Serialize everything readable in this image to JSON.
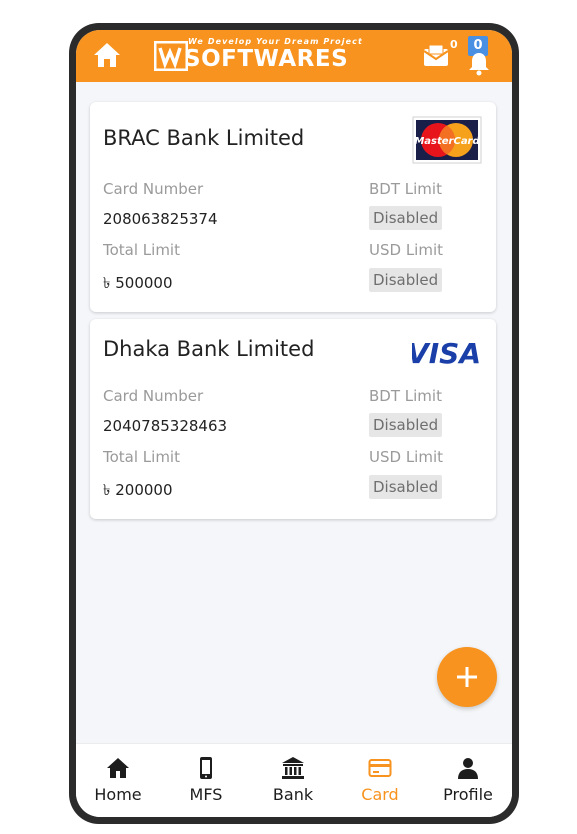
{
  "header": {
    "logo_tagline": "We Develop Your Dream Project",
    "logo_brand": "SOFTWARES",
    "mail_count": "0",
    "notification_count": "0",
    "accent_color": "#f7931e"
  },
  "cards": [
    {
      "bank_name": "BRAC Bank Limited",
      "network": "MasterCard",
      "card_number_label": "Card Number",
      "card_number": "208063825374",
      "total_limit_label": "Total Limit",
      "total_limit": "৳ 500000",
      "bdt_limit_label": "BDT Limit",
      "bdt_limit": "Disabled",
      "usd_limit_label": "USD Limit",
      "usd_limit": "Disabled"
    },
    {
      "bank_name": "Dhaka Bank Limited",
      "network": "VISA",
      "card_number_label": "Card Number",
      "card_number": "2040785328463",
      "total_limit_label": "Total Limit",
      "total_limit": "৳ 200000",
      "bdt_limit_label": "BDT Limit",
      "bdt_limit": "Disabled",
      "usd_limit_label": "USD Limit",
      "usd_limit": "Disabled"
    }
  ],
  "fab": {
    "icon": "plus-icon"
  },
  "bottom_nav": [
    {
      "label": "Home",
      "icon": "home-icon"
    },
    {
      "label": "MFS",
      "icon": "mobile-icon"
    },
    {
      "label": "Bank",
      "icon": "bank-icon"
    },
    {
      "label": "Card",
      "icon": "credit-card-icon",
      "active": true
    },
    {
      "label": "Profile",
      "icon": "user-icon"
    }
  ]
}
